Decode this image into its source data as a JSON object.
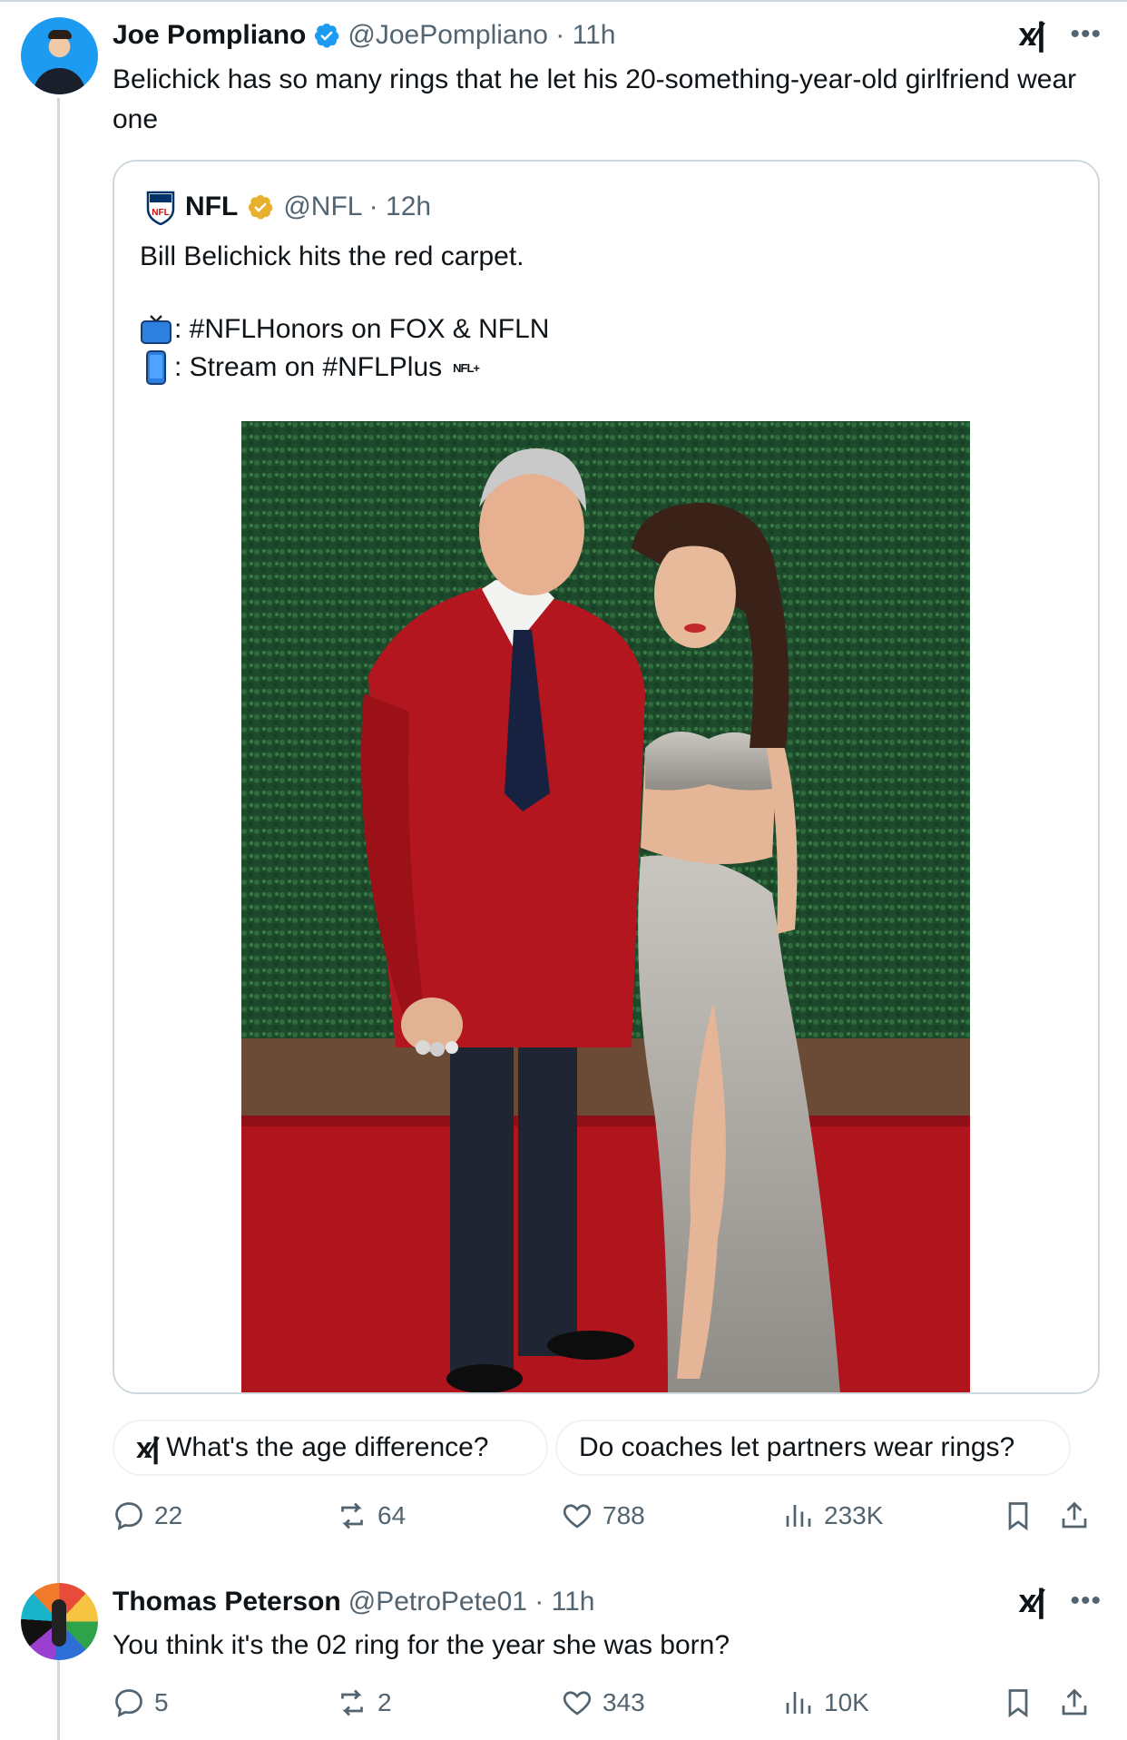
{
  "main_post": {
    "author_name": "Joe Pompliano",
    "handle_time": "@JoePompliano · 11h",
    "text": "Belichick has so many rings that he let his 20-something-year-old girlfriend wear one",
    "stats": {
      "replies": "22",
      "reposts": "64",
      "likes": "788",
      "views": "233K"
    }
  },
  "quoted_post": {
    "author_name": "NFL",
    "handle_time": "@NFL · 12h",
    "line1": "Bill Belichick hits the red carpet.",
    "line2": ": #NFLHonors on FOX & NFLN",
    "line3": ": Stream on #NFLPlus",
    "tiny_logo": "NFL+"
  },
  "grok_suggestions": [
    "What's the age difference?",
    "Do coaches let partners wear rings?"
  ],
  "reply_post": {
    "author_name": "Thomas Peterson",
    "handle_time": "@PetroPete01 · 11h",
    "text": "You think it's the 02 ring for the year she was born?",
    "stats": {
      "replies": "5",
      "reposts": "2",
      "likes": "343",
      "views": "10K"
    }
  },
  "icons": {
    "more": "more-horizontal-icon",
    "grok": "grok-icon",
    "verified_blue": "#1d9bf0",
    "verified_gold": "#e8b02c"
  },
  "colors": {
    "text": "#0f1419",
    "secondary": "#536471",
    "border": "#cfd9de"
  }
}
